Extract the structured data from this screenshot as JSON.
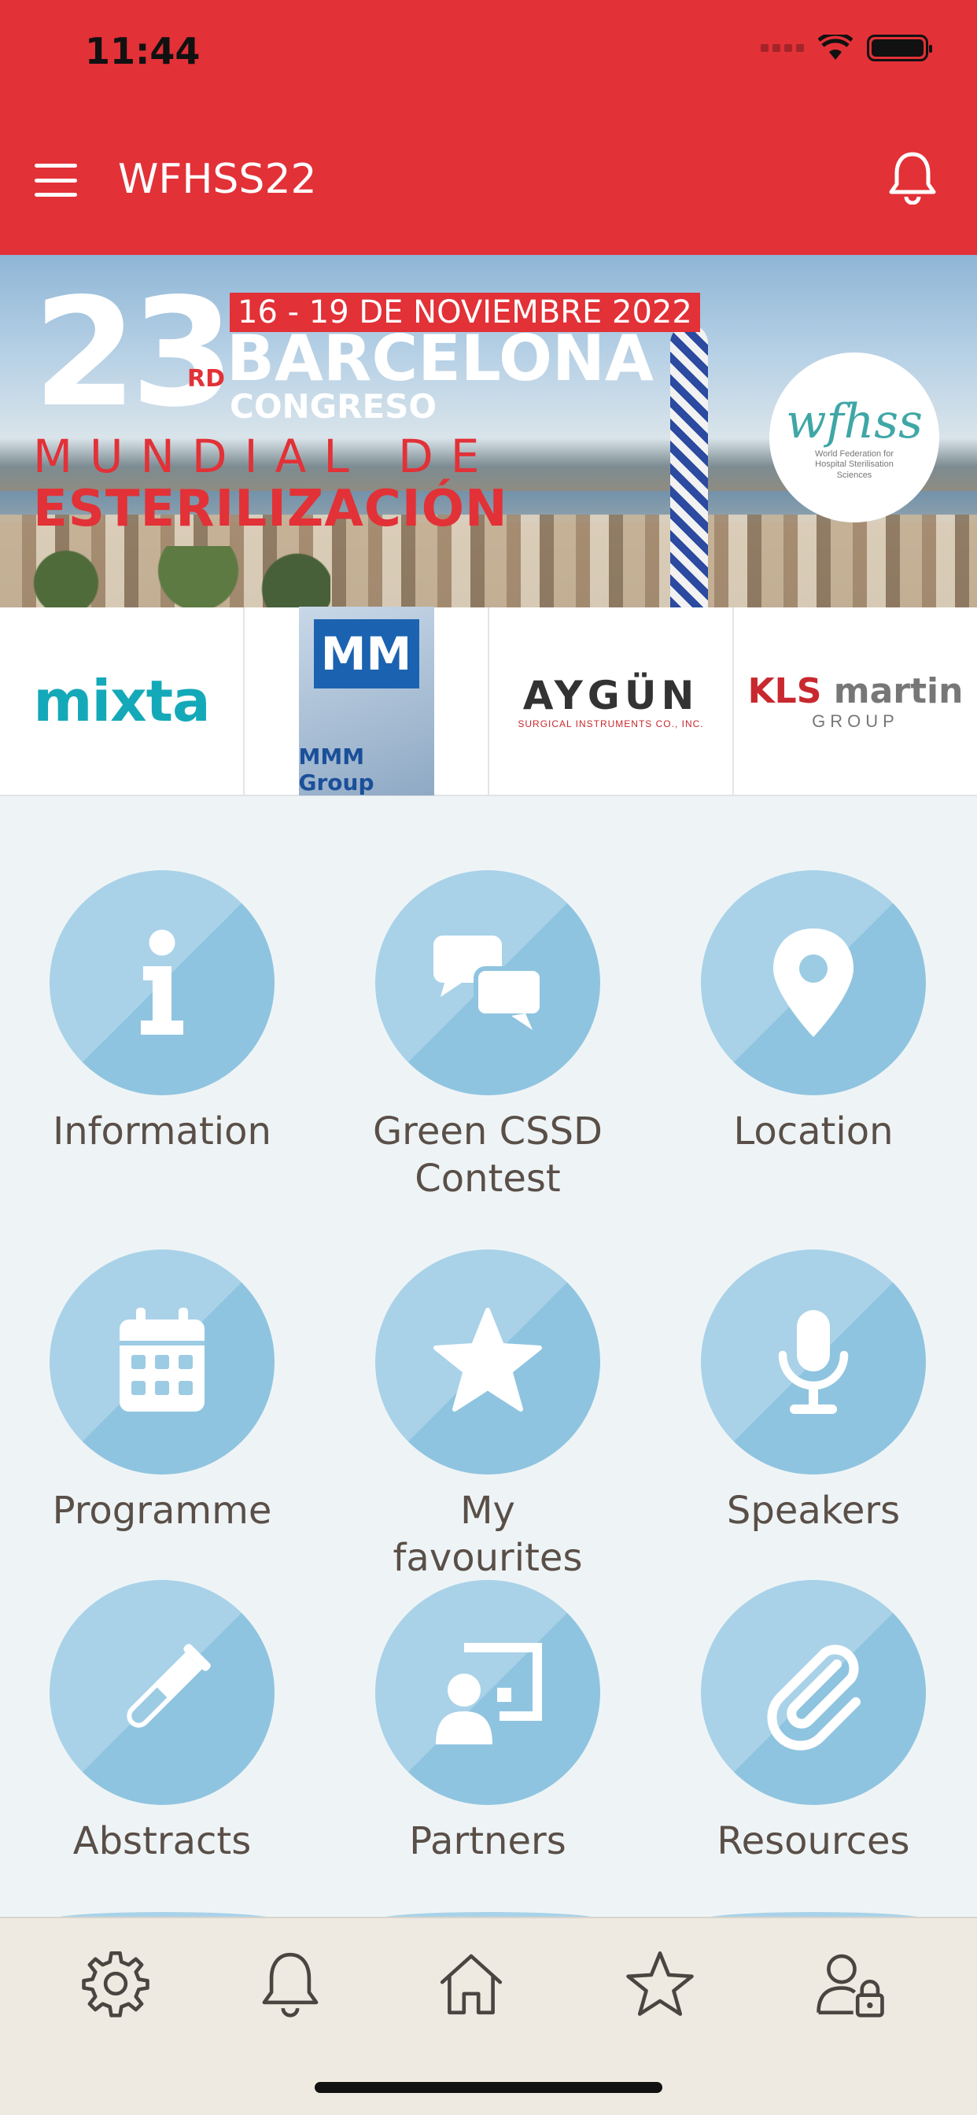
{
  "status_bar": {
    "time": "11:44"
  },
  "header": {
    "title": "WFHSS22"
  },
  "banner": {
    "edition": "23",
    "ordinal": "RD",
    "dates": "16 - 19 DE NOVIEMBRE 2022",
    "city": "BARCELONA",
    "congreso": "CONGRESO",
    "line1": "MUNDIAL DE",
    "line2": "ESTERILIZACIÓN",
    "logo_mark": "wfhss",
    "logo_sub": "World Federation for Hospital Sterilisation Sciences"
  },
  "sponsors": [
    {
      "name": "mixta"
    },
    {
      "name": "MM",
      "label": "MMM Group"
    },
    {
      "name": "AYGÜN",
      "sub": "SURGICAL INSTRUMENTS CO., INC."
    },
    {
      "name_a": "KLS",
      "name_b": "martin",
      "sub": "GROUP"
    }
  ],
  "tiles": [
    {
      "label": "Information",
      "icon": "info-icon"
    },
    {
      "label": "Green CSSD Contest",
      "icon": "chat-icon"
    },
    {
      "label": "Location",
      "icon": "map-pin-icon"
    },
    {
      "label": "Programme",
      "icon": "calendar-icon"
    },
    {
      "label": "My favourites",
      "icon": "star-icon"
    },
    {
      "label": "Speakers",
      "icon": "microphone-icon"
    },
    {
      "label": "Abstracts",
      "icon": "test-tube-icon"
    },
    {
      "label": "Partners",
      "icon": "presentation-icon"
    },
    {
      "label": "Resources",
      "icon": "paperclip-icon"
    }
  ],
  "bottom_nav": [
    "gear-icon",
    "bell-icon",
    "home-icon",
    "star-icon",
    "user-lock-icon"
  ],
  "colors": {
    "primary": "#e23137",
    "tile_light": "#a9d2e8",
    "tile_dark": "#8fc4e0",
    "label": "#5a4f48",
    "nav_bg": "#eeeae2"
  }
}
